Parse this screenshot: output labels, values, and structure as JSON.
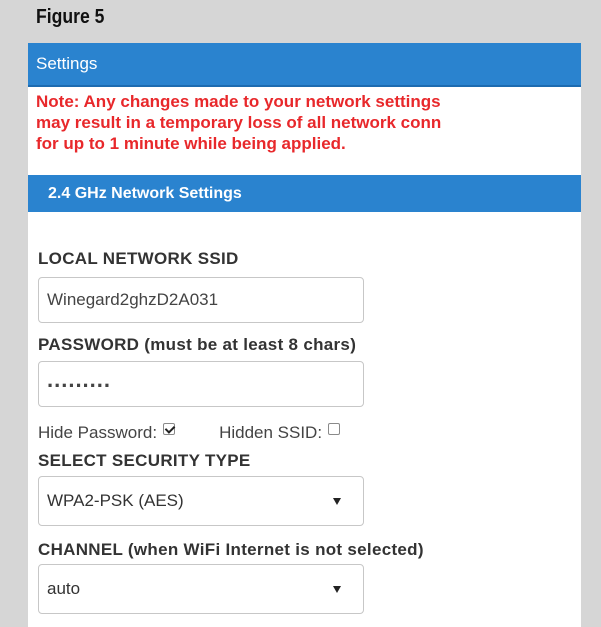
{
  "figure_label": "Figure 5",
  "settings_header": "Settings",
  "note": [
    "Note: Any changes made to your network settings",
    "may result in a temporary loss of all network conn",
    "for up to 1 minute while being applied."
  ],
  "section_header": "2.4 GHz Network Settings",
  "ssid": {
    "label": "LOCAL NETWORK SSID",
    "value": "Winegard2ghzD2A031"
  },
  "password": {
    "label": "PASSWORD (must be at least 8 chars)",
    "value": "........."
  },
  "hide_password": {
    "label": "Hide Password:",
    "checked": true
  },
  "hidden_ssid": {
    "label": "Hidden SSID:",
    "checked": false
  },
  "security": {
    "label": "SELECT SECURITY TYPE",
    "selected": "WPA2-PSK (AES)"
  },
  "channel": {
    "label": "CHANNEL (when WiFi Internet is not selected)",
    "selected": "auto"
  },
  "colors": {
    "header_blue": "#2a83cf",
    "note_red": "#e8282b",
    "background_gray": "#d6d6d6"
  }
}
